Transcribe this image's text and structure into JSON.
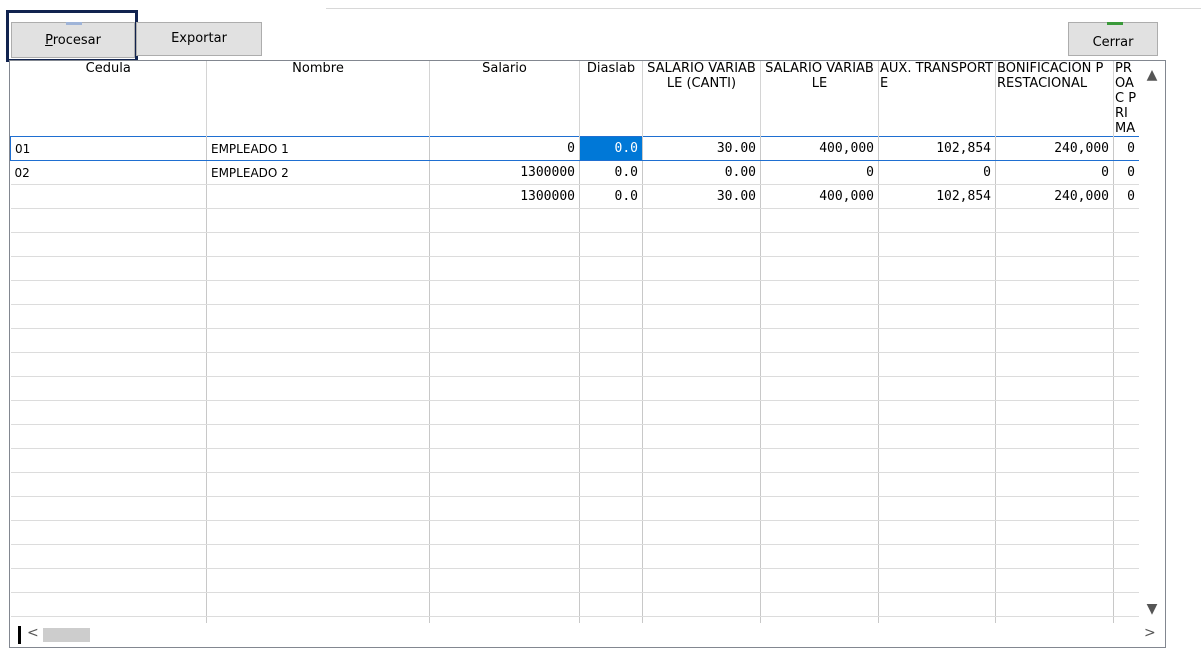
{
  "toolbar": {
    "procesar_label": "Procesar",
    "exportar_label": "Exportar",
    "cerrar_label": "Cerrar"
  },
  "grid": {
    "columns": [
      "Cedula",
      "Nombre",
      "Salario",
      "Diaslab",
      "SALARIO VARIABLE (CANTI)",
      "SALARIO VARIABLE",
      "AUX. TRANSPORTE",
      "BONIFICACION PRESTACIONAL",
      "PROAC PRIMA"
    ],
    "rows": [
      [
        "01",
        "EMPLEADO 1",
        "0",
        "0.0",
        "30.00",
        "400,000",
        "102,854",
        "240,000",
        "0"
      ],
      [
        "02",
        "EMPLEADO 2",
        "1300000",
        "0.0",
        "0.00",
        "0",
        "0",
        "0",
        "0"
      ],
      [
        "",
        "",
        "1300000",
        "0.0",
        "30.00",
        "400,000",
        "102,854",
        "240,000",
        "0"
      ]
    ],
    "empty_row_count": 18,
    "selected_cell": {
      "row": 0,
      "column": 3
    }
  },
  "colors": {
    "selection": "#0078d7",
    "focus_border": "#11234f",
    "button_face": "#e1e1e1"
  },
  "icons": {
    "vscroll_up": "▲",
    "vscroll_down": "▼",
    "hscroll_left": "<",
    "hscroll_right": ">"
  }
}
